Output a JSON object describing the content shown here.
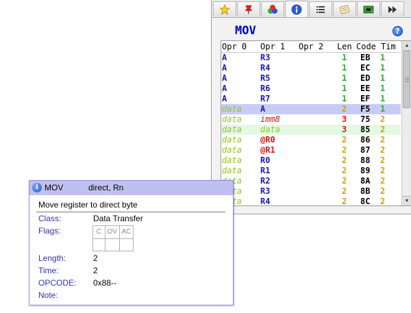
{
  "tabs": [
    {
      "icon": "star-icon"
    },
    {
      "icon": "pin-icon"
    },
    {
      "icon": "balls-icon"
    },
    {
      "icon": "info-icon",
      "active": true
    },
    {
      "icon": "list-icon"
    },
    {
      "icon": "note-icon"
    },
    {
      "icon": "board-icon"
    },
    {
      "icon": "fast-forward-icon"
    }
  ],
  "instruction": {
    "mnemonic": "MOV",
    "help_icon": "?"
  },
  "table": {
    "headers": [
      "Opr 0",
      "Opr 1",
      "Opr 2",
      "Len",
      "Code",
      "Tim"
    ],
    "rows": [
      {
        "opr0": "A",
        "opr1": "R3",
        "opr2": "",
        "len": "1",
        "code": "EB",
        "tim": "1"
      },
      {
        "opr0": "A",
        "opr1": "R4",
        "opr2": "",
        "len": "1",
        "code": "EC",
        "tim": "1"
      },
      {
        "opr0": "A",
        "opr1": "R5",
        "opr2": "",
        "len": "1",
        "code": "ED",
        "tim": "1"
      },
      {
        "opr0": "A",
        "opr1": "R6",
        "opr2": "",
        "len": "1",
        "code": "EE",
        "tim": "1"
      },
      {
        "opr0": "A",
        "opr1": "R7",
        "opr2": "",
        "len": "1",
        "code": "EF",
        "tim": "1"
      },
      {
        "opr0": "data",
        "opr1": "A",
        "opr2": "",
        "len": "2",
        "code": "F5",
        "tim": "1",
        "state": "selected"
      },
      {
        "opr0": "data",
        "opr1": "imm8",
        "opr2": "",
        "len": "3",
        "code": "75",
        "tim": "2"
      },
      {
        "opr0": "data",
        "opr1": "data",
        "opr2": "",
        "len": "3",
        "code": "85",
        "tim": "2",
        "state": "hover"
      },
      {
        "opr0": "data",
        "opr1": "@R0",
        "opr2": "",
        "len": "2",
        "code": "86",
        "tim": "2"
      },
      {
        "opr0": "data",
        "opr1": "@R1",
        "opr2": "",
        "len": "2",
        "code": "87",
        "tim": "2"
      },
      {
        "opr0": "data",
        "opr1": "R0",
        "opr2": "",
        "len": "2",
        "code": "88",
        "tim": "2"
      },
      {
        "opr0": "data",
        "opr1": "R1",
        "opr2": "",
        "len": "2",
        "code": "89",
        "tim": "2"
      },
      {
        "opr0": "data",
        "opr1": "R2",
        "opr2": "",
        "len": "2",
        "code": "8A",
        "tim": "2"
      },
      {
        "opr0": "data",
        "opr1": "R3",
        "opr2": "",
        "len": "2",
        "code": "8B",
        "tim": "2"
      },
      {
        "opr0": "data",
        "opr1": "R4",
        "opr2": "",
        "len": "2",
        "code": "8C",
        "tim": "2"
      }
    ]
  },
  "tooltip": {
    "mnemonic": "MOV",
    "operands": "direct, Rn",
    "description": "Move register to direct byte",
    "class_label": "Class:",
    "class_value": "Data Transfer",
    "flags_label": "Flags:",
    "flags": [
      "C",
      "OV",
      "AC"
    ],
    "length_label": "Length:",
    "length_value": "2",
    "time_label": "Time:",
    "time_value": "2",
    "opcode_label": "OPCODE:",
    "opcode_value": "0x88--",
    "note_label": "Note:",
    "note_value": ""
  },
  "colors": {
    "mnemonic": "#0000c8",
    "selected_row": "#c8ccf4",
    "hover_row": "#e4f8e4",
    "tooltip_header": "#c0c0f0",
    "label": "#3030b4"
  }
}
